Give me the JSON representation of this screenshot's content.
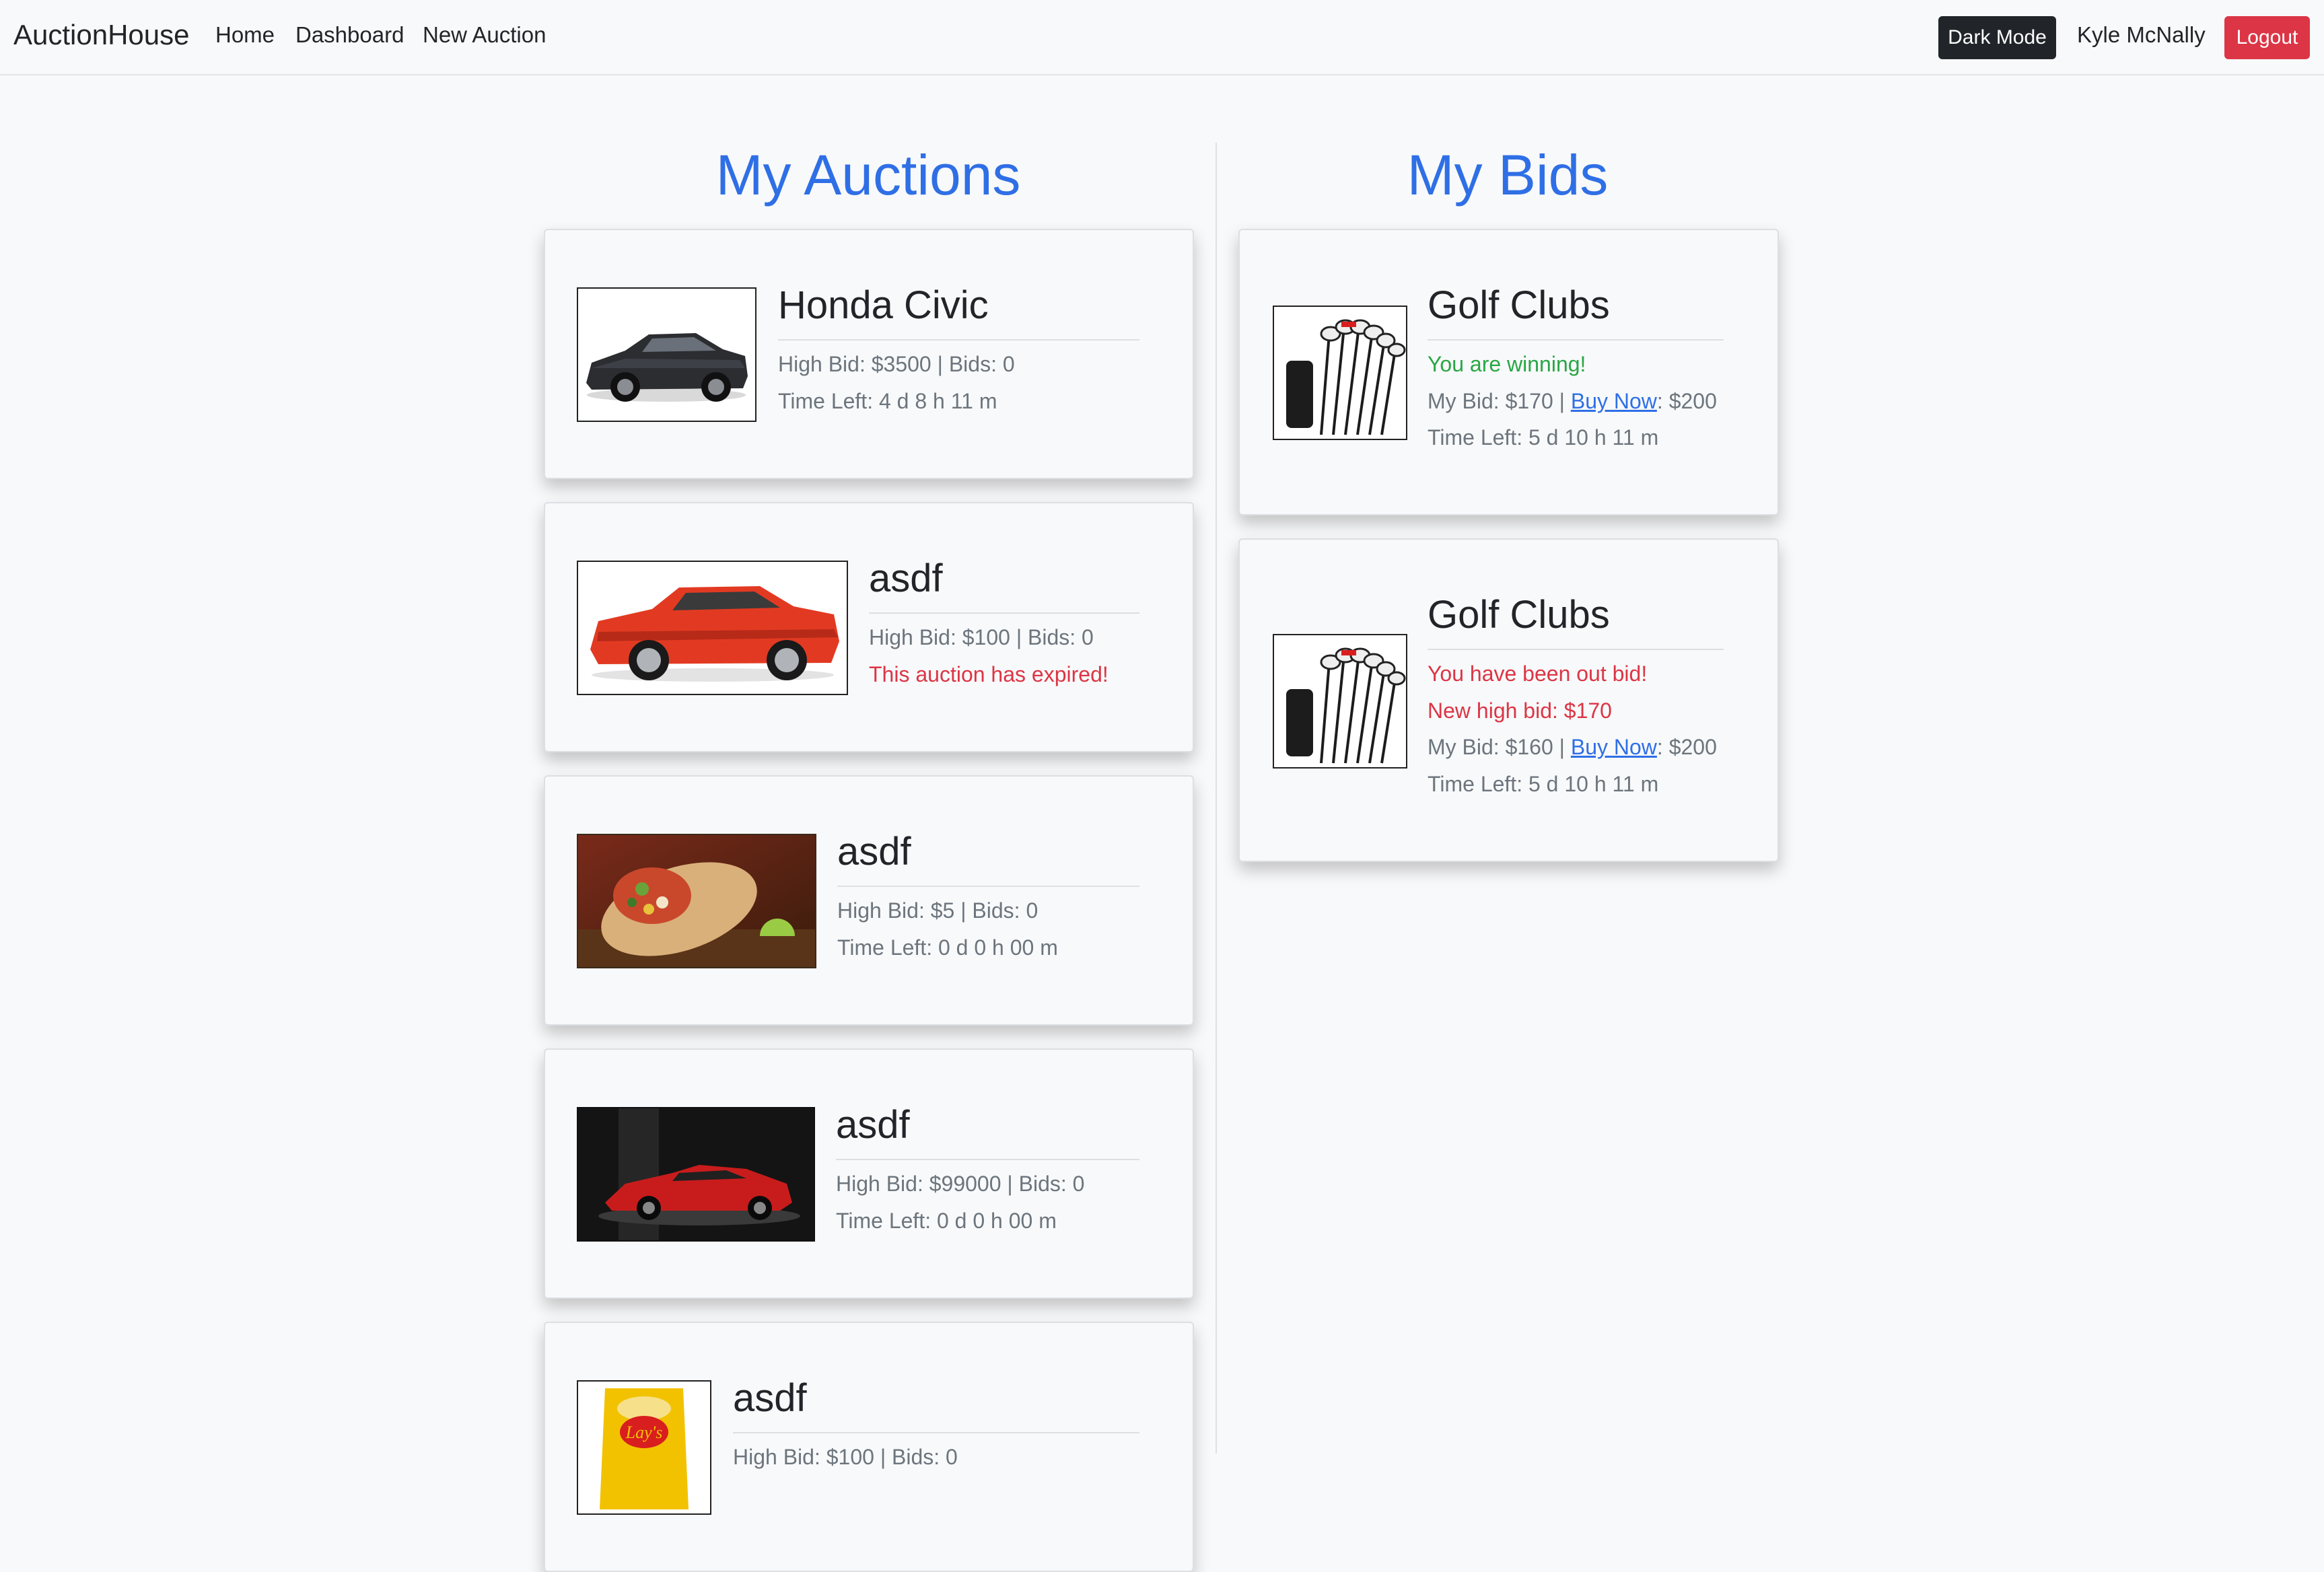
{
  "navbar": {
    "brand": "AuctionHouse",
    "links": [
      "Home",
      "Dashboard",
      "New Auction"
    ],
    "dark_mode_label": "Dark Mode",
    "user": "Kyle McNally",
    "logout_label": "Logout"
  },
  "my_auctions": {
    "title": "My Auctions",
    "items": [
      {
        "title": "Honda Civic",
        "line1": "High Bid: $3500 | Bids: 0",
        "line2": "Time Left: 4 d 8 h 11 m",
        "image": "black-sedan"
      },
      {
        "title": "asdf",
        "line1": "High Bid: $100 | Bids: 0",
        "line2": "This auction has expired!",
        "image": "orange-muscle-car"
      },
      {
        "title": "asdf",
        "line1": "High Bid: $5 | Bids: 0",
        "line2": "Time Left: 0 d 0 h 00 m",
        "image": "burrito"
      },
      {
        "title": "asdf",
        "line1": "High Bid: $99000 | Bids: 0",
        "line2": "Time Left: 0 d 0 h 00 m",
        "image": "red-sports-car"
      },
      {
        "title": "asdf",
        "line1": "High Bid: $100 | Bids: 0",
        "image": "chips-bag"
      }
    ]
  },
  "my_bids": {
    "title": "My Bids",
    "items": [
      {
        "title": "Golf Clubs",
        "status": "You are winning!",
        "my_bid_prefix": "My Bid: $170 | ",
        "buy_now_label": "Buy Now",
        "buy_now_suffix": ": $200",
        "time_left": "Time Left: 5 d 10 h 11 m",
        "image": "golf-clubs"
      },
      {
        "title": "Golf Clubs",
        "status": "You have been out bid!",
        "status2": "New high bid: $170",
        "my_bid_prefix": "My Bid: $160 | ",
        "buy_now_label": "Buy Now",
        "buy_now_suffix": ": $200",
        "time_left": "Time Left: 5 d 10 h 11 m",
        "image": "golf-clubs"
      }
    ]
  },
  "colors": {
    "accent": "#2f6fe6",
    "success": "#28a745",
    "danger": "#dc3545",
    "muted": "#6c757d"
  }
}
